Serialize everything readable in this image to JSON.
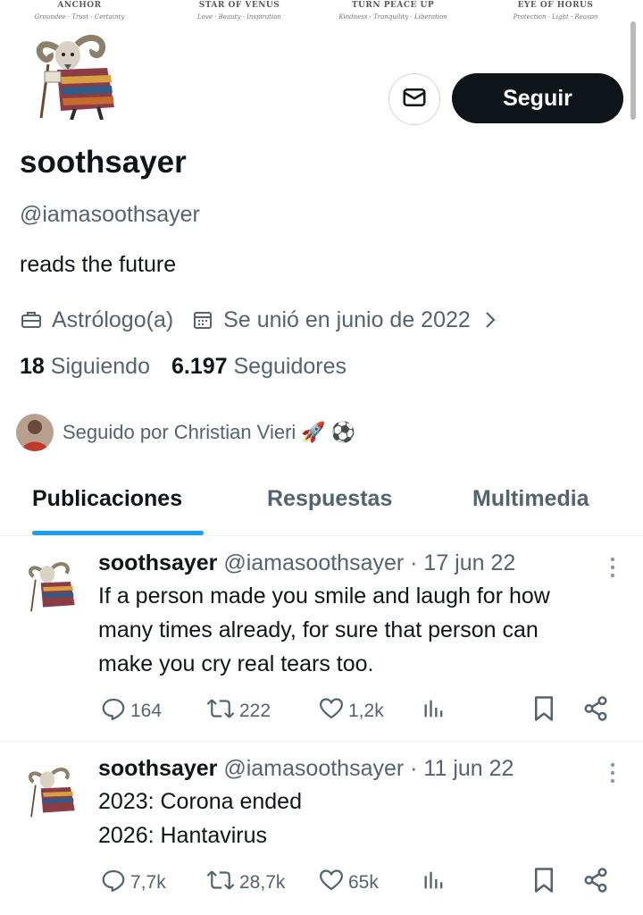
{
  "banner": [
    {
      "title": "ANCHOR",
      "sub": "Groundee · Trust · Certainty"
    },
    {
      "title": "STAR OF VENUS",
      "sub": "Love · Beauty · Inspiration"
    },
    {
      "title": "TURN PEACE UP",
      "sub": "Kindness · Tranquility · Liberation"
    },
    {
      "title": "EYE OF HORUS",
      "sub": "Protection · Light · Reason"
    }
  ],
  "profile": {
    "follow_label": "Seguir",
    "name": "soothsayer",
    "handle": "@iamasoothsayer",
    "bio": "reads the future",
    "category": "Astrólogo(a)",
    "joined": "Se unió en junio de 2022",
    "following_count": "18",
    "following_label": "Siguiendo",
    "followers_count": "6.197",
    "followers_label": "Seguidores",
    "followed_by": "Seguido por Christian Vieri 🚀 ⚽"
  },
  "tabs": [
    {
      "label": "Publicaciones",
      "active": true
    },
    {
      "label": "Respuestas",
      "active": false
    },
    {
      "label": "Multimedia",
      "active": false
    }
  ],
  "tweets": [
    {
      "name": "soothsayer",
      "meta": "@iamasoothsayer · 17 jun 22",
      "lines": [
        "If a person made you smile and laugh for how",
        "many times already, for sure that person can",
        "make you cry real tears too."
      ],
      "replies": "164",
      "retweets": "222",
      "likes": "1,2k"
    },
    {
      "name": "soothsayer",
      "meta": "@iamasoothsayer · 11 jun 22",
      "lines": [
        "2023: Corona ended",
        "2026: Hantavirus"
      ],
      "replies": "7,7k",
      "retweets": "28,7k",
      "likes": "65k"
    }
  ],
  "colors": {
    "accent": "#1d9bf0",
    "text": "#0f1419",
    "secondary": "#536471",
    "button_dark": "#0f1419"
  }
}
